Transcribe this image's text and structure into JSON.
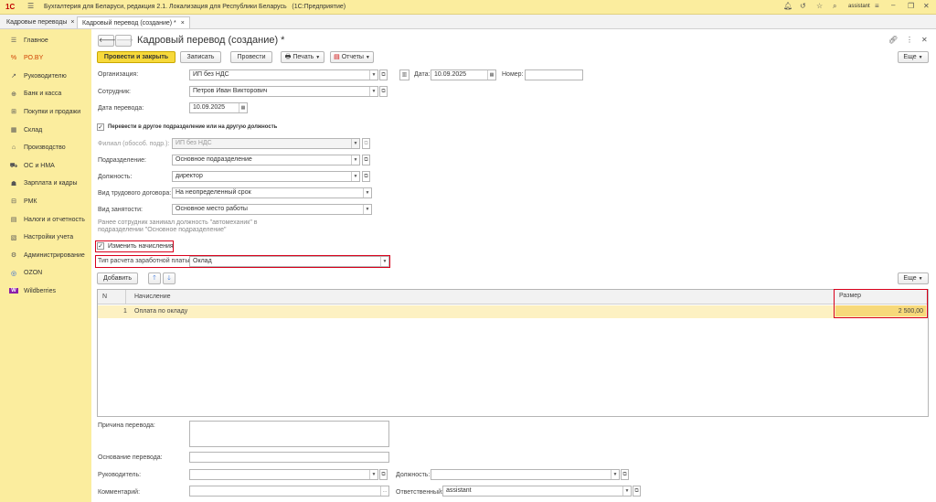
{
  "app": {
    "title": "Бухгалтерия для Беларуси, редакция 2.1. Локализация для Республики Беларусь   (1С:Предприятие)",
    "user": "assistant",
    "logo": "1С"
  },
  "tabs": [
    {
      "label": "Кадровые переводы",
      "close": "×"
    },
    {
      "label": "Кадровый перевод (создание) *",
      "close": "×"
    }
  ],
  "sidebar": {
    "items": [
      {
        "label": "Главное",
        "icon": "menu-icon"
      },
      {
        "label": "РО.BY",
        "icon": "percent-icon"
      },
      {
        "label": "Руководителю",
        "icon": "chart-icon"
      },
      {
        "label": "Банк и касса",
        "icon": "bank-icon"
      },
      {
        "label": "Покупки и продажи",
        "icon": "cart-icon"
      },
      {
        "label": "Склад",
        "icon": "warehouse-icon"
      },
      {
        "label": "Производство",
        "icon": "factory-icon"
      },
      {
        "label": "ОС и НМА",
        "icon": "truck-icon"
      },
      {
        "label": "Зарплата и кадры",
        "icon": "person-icon"
      },
      {
        "label": "РМК",
        "icon": "pos-icon"
      },
      {
        "label": "Налоги и отчетность",
        "icon": "report-icon"
      },
      {
        "label": "Настройки учета",
        "icon": "settings-doc-icon"
      },
      {
        "label": "Администрирование",
        "icon": "gear-icon"
      },
      {
        "label": "OZON",
        "icon": "ozon-icon"
      },
      {
        "label": "Wildberries",
        "icon": "wildberries-icon"
      }
    ]
  },
  "form": {
    "title": "Кадровый перевод (создание) *",
    "toolbar": {
      "post_close": "Провести и закрыть",
      "save": "Записать",
      "post": "Провести",
      "print": "Печать",
      "reports": "Отчеты",
      "more": "Еще"
    },
    "org_label": "Организация:",
    "org_value": "ИП без НДС",
    "date_label": "Дата:",
    "date_value": "10.09.2025",
    "number_label": "Номер:",
    "number_value": "",
    "employee_label": "Сотрудник:",
    "employee_value": "Петров Иван Викторович",
    "transfer_date_label": "Дата перевода:",
    "transfer_date_value": "10.09.2025",
    "move_checkbox_label": "Перевести в другое подразделение или на другую должность",
    "branch_label": "Филиал (обособ. подр.):",
    "branch_value": "ИП без НДС",
    "dept_label": "Подразделение:",
    "dept_value": "Основное подразделение",
    "position_label": "Должность:",
    "position_value": "директор",
    "contract_label": "Вид трудового договора:",
    "contract_value": "На неопределенный срок",
    "employment_label": "Вид занятости:",
    "employment_value": "Основное место работы",
    "note_line1": "Ранее сотрудник занимал должность \"автомеханик\" в",
    "note_line2": "подразделении \"Основное подразделение\"",
    "change_accruals_label": "Изменить начисления",
    "pay_type_label": "Тип расчета заработной платы:",
    "pay_type_value": "Оклад",
    "add_button": "Добавить",
    "table_more": "Еще",
    "table": {
      "headers": {
        "n": "N",
        "accrual": "Начисление",
        "amount": "Размер"
      },
      "rows": [
        {
          "n": "1",
          "accrual": "Оплата по окладу",
          "amount": "2 500,00"
        }
      ]
    },
    "reason_label": "Причина перевода:",
    "reason_value": "",
    "basis_label": "Основание перевода:",
    "basis_value": "",
    "manager_label": "Руководитель:",
    "manager_value": "",
    "manager_position_label": "Должность:",
    "manager_position_value": "",
    "comment_label": "Комментарий:",
    "comment_value": "",
    "responsible_label": "Ответственный:",
    "responsible_value": "assistant"
  },
  "colors": {
    "accent": "#fbed9e",
    "primary_button": "#f7d93b",
    "highlight_row": "#fdf1c2",
    "red_frame": "#d9001b"
  }
}
